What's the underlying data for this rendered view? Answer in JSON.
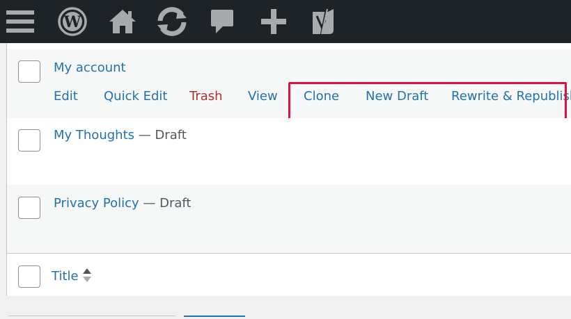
{
  "admin_bar": {
    "icons": [
      "menu-icon",
      "wordpress-logo-icon",
      "home-icon",
      "refresh-icon",
      "comment-icon",
      "plus-icon",
      "yoast-icon"
    ],
    "background": "#1d2327"
  },
  "rows": [
    {
      "title": "My account",
      "state": "",
      "actions": {
        "edit": "Edit",
        "quick_edit": "Quick Edit",
        "trash": "Trash",
        "view": "View",
        "clone": "Clone",
        "new_draft": "New Draft",
        "rewrite": "Rewrite & Republish"
      }
    },
    {
      "title": "My Thoughts",
      "state": " — Draft"
    },
    {
      "title": "Privacy Policy",
      "state": " — Draft"
    }
  ],
  "footer": {
    "column_title": "Title"
  },
  "colors": {
    "link": "#2271b1",
    "trash": "#b32d2e",
    "highlight": "#e0103d"
  }
}
